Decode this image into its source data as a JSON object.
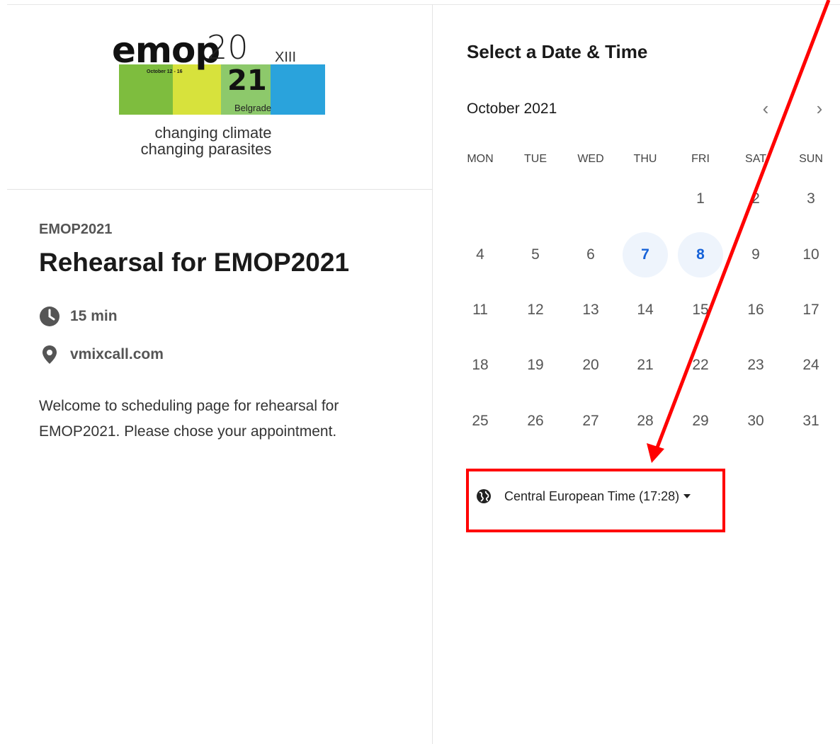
{
  "logo": {
    "word": "emop",
    "year_top": "20",
    "edition": "XIII",
    "dates": "October 12 - 16",
    "year_bottom": "21",
    "city": "Belgrade",
    "tagline_1": "changing climate",
    "tagline_2": "changing parasites"
  },
  "event": {
    "organizer": "EMOP2021",
    "title": "Rehearsal for EMOP2021",
    "duration": "15 min",
    "location": "vmixcall.com",
    "description": "Welcome to scheduling page for rehearsal for EMOP2021. Please chose your appointment."
  },
  "calendar": {
    "heading": "Select a Date & Time",
    "month_label": "October 2021",
    "prev_glyph": "‹",
    "next_glyph": "›",
    "weekdays": [
      "MON",
      "TUE",
      "WED",
      "THU",
      "FRI",
      "SAT",
      "SUN"
    ],
    "weeks": [
      [
        "",
        "",
        "",
        "",
        "1",
        "2",
        "3"
      ],
      [
        "4",
        "5",
        "6",
        "7",
        "8",
        "9",
        "10"
      ],
      [
        "11",
        "12",
        "13",
        "14",
        "15",
        "16",
        "17"
      ],
      [
        "18",
        "19",
        "20",
        "21",
        "22",
        "23",
        "24"
      ],
      [
        "25",
        "26",
        "27",
        "28",
        "29",
        "30",
        "31"
      ]
    ],
    "available_days": [
      "7",
      "8"
    ]
  },
  "timezone": {
    "label": "Central European Time (17:28)"
  },
  "colors": {
    "accent": "#1662d8",
    "available_bg": "#eef4fc",
    "annotation": "#ff0000"
  }
}
